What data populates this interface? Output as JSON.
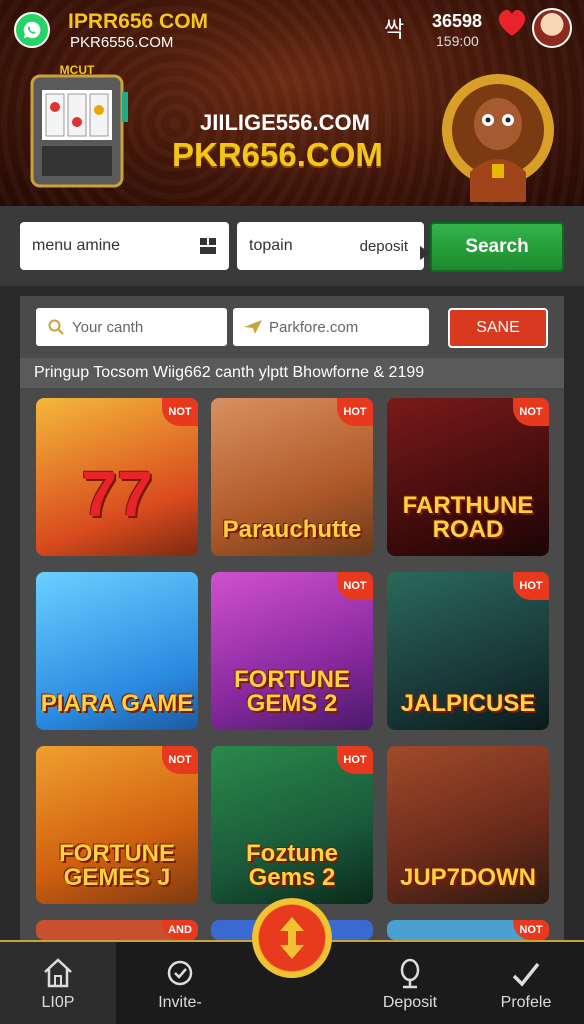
{
  "header": {
    "site_top": "IPRR656 COM",
    "site_sub": "PKR6556.COM",
    "gift_glyph": "싹",
    "count_top": "36598",
    "count_sub": "159:00",
    "hero_line1": "JIILIGE556.COM",
    "hero_line2": "PKR656.COM",
    "slot_label": "MCUT"
  },
  "search": {
    "menu_value": "menu amine",
    "topain_value": "topain",
    "deposit_label": "deposit",
    "button_label": "Search"
  },
  "filters": {
    "search_placeholder": "Your canth",
    "site_placeholder": "Parkfore.com",
    "save_label": "SANE"
  },
  "promo_text": "Pringup Tocsom Wiig662 canth ylptt   Bhowforne & 2199",
  "games": [
    {
      "title": "77",
      "tag": "NOT"
    },
    {
      "title": "Parauchutte",
      "tag": "HOT"
    },
    {
      "title": "FARTHUNE ROAD",
      "tag": "NOT"
    },
    {
      "title": "PIARA GAME",
      "tag": ""
    },
    {
      "title": "FORTUNE GEMS 2",
      "tag": "NOT"
    },
    {
      "title": "JALPICUSE",
      "tag": "HOT"
    },
    {
      "title": "FORTUNE GEMES J",
      "tag": "NOT"
    },
    {
      "title": "Foztune Gems 2",
      "tag": "HOT"
    },
    {
      "title": "JUP7DOWN",
      "tag": ""
    }
  ],
  "partial_tags": [
    "AND",
    "NOT"
  ],
  "nav": {
    "home": "LI0P",
    "invite": "Invite-",
    "deposit": "Deposit",
    "profile": "Profele"
  },
  "colors": {
    "accent": "#f5c518",
    "search_green": "#2ba641",
    "save_red": "#d9391e",
    "hot_tag": "#e8381e"
  }
}
